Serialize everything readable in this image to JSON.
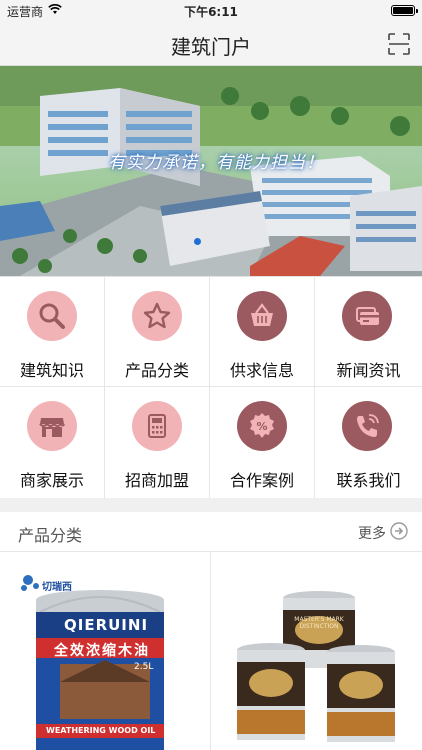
{
  "status_bar": {
    "carrier": "运营商",
    "time": "下午6:11",
    "battery_level": 1.0
  },
  "header": {
    "title": "建筑门户",
    "scan_icon": "scan-icon"
  },
  "banner": {
    "slogan": "有实力承诺，有能力担当！"
  },
  "categories": [
    {
      "label": "建筑知识",
      "icon": "search-icon",
      "color": "#f2b3b7"
    },
    {
      "label": "产品分类",
      "icon": "star-icon",
      "color": "#f2b3b7"
    },
    {
      "label": "供求信息",
      "icon": "basket-icon",
      "color": "#9a5a5f"
    },
    {
      "label": "新闻资讯",
      "icon": "card-icon",
      "color": "#9a5a5f"
    },
    {
      "label": "商家展示",
      "icon": "store-icon",
      "color": "#f2b3b7"
    },
    {
      "label": "招商加盟",
      "icon": "calculator-icon",
      "color": "#f2b3b7"
    },
    {
      "label": "合作案例",
      "icon": "percent-icon",
      "color": "#9a5a5f"
    },
    {
      "label": "联系我们",
      "icon": "phone-icon",
      "color": "#9a5a5f"
    }
  ],
  "products_section": {
    "title": "产品分类",
    "more_label": "更多",
    "items": [
      {
        "brand_cn": "切瑞西",
        "brand_en": "QIERUINI",
        "name": "全效浓缩木油",
        "sub": "WEATHERING WOOD OIL",
        "volume": "2.5L"
      },
      {
        "brand_en": "MASTER'S MARK DISTINCTION"
      }
    ]
  }
}
